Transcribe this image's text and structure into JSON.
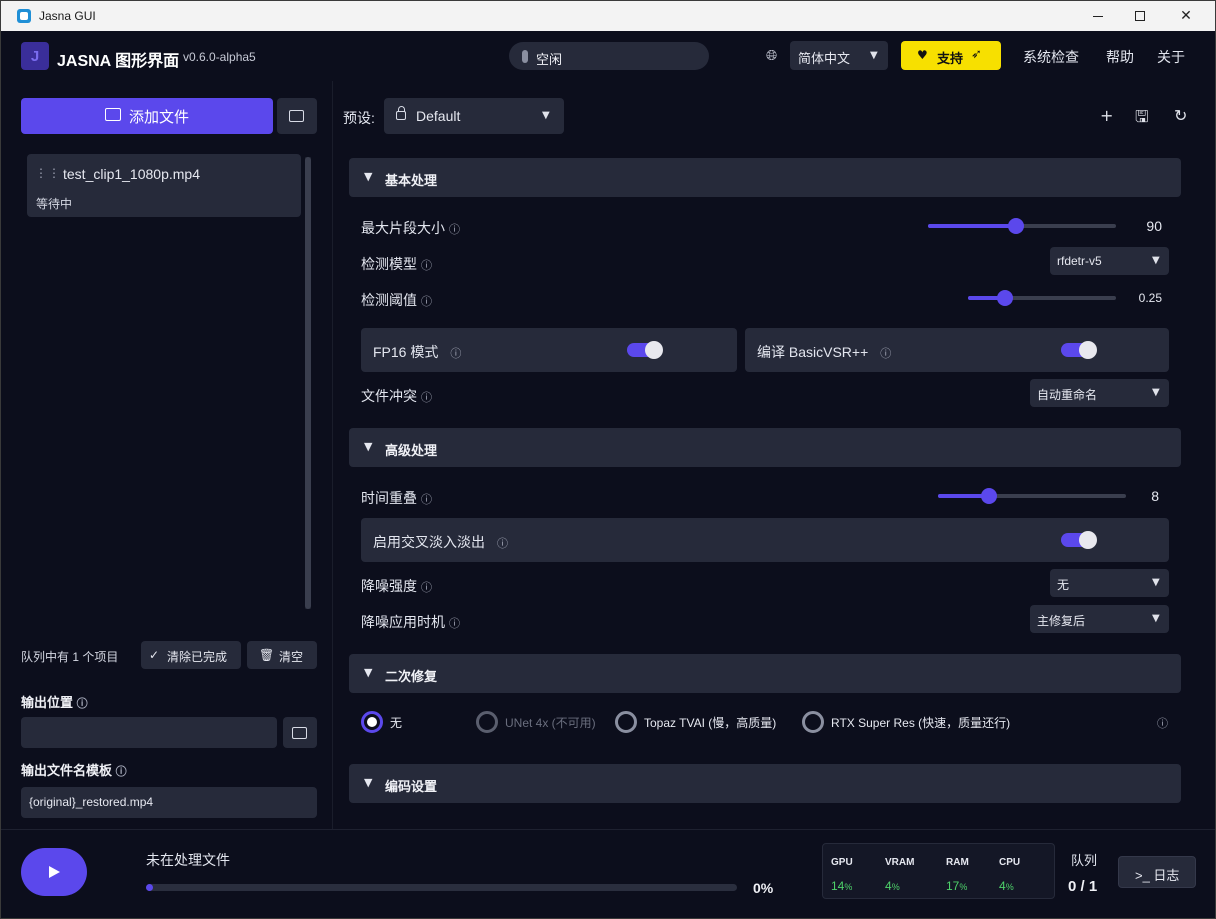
{
  "window": {
    "title": "Jasna GUI"
  },
  "header": {
    "logo_letter": "J",
    "app_name": "JASNA 图形界面",
    "version": "v0.6.0-alpha5",
    "status": "空闲",
    "language": "简体中文",
    "support_label": "支持",
    "links": [
      "系统检查",
      "帮助",
      "关于"
    ]
  },
  "left": {
    "add_files_label": "添加文件",
    "queue": [
      {
        "file": "test_clip1_1080p.mp4",
        "state": "等待中"
      }
    ],
    "queue_count": "队列中有 1 个项目",
    "clear_completed_label": "清除已完成",
    "clear_label": "清空",
    "output_location_label": "输出位置",
    "output_location_value": "",
    "filename_template_label": "输出文件名模板",
    "filename_template_value": "{original}_restored.mp4"
  },
  "right": {
    "preset_label": "预设:",
    "preset_value": "Default",
    "sections": {
      "basic": "基本处理",
      "advanced": "高级处理",
      "secondary": "二次修复",
      "encoding": "编码设置"
    },
    "basic": {
      "max_segment": {
        "label": "最大片段大小",
        "value": "90",
        "fraction": 0.47
      },
      "detection_model": {
        "label": "检测模型",
        "value": "rfdetr-v5"
      },
      "detection_threshold": {
        "label": "检测阈值",
        "value": "0.25",
        "fraction": 0.25
      },
      "fp16": {
        "label": "FP16 模式",
        "on": true
      },
      "compile": {
        "label": "编译 BasicVSR++",
        "on": true
      },
      "file_conflict": {
        "label": "文件冲突",
        "value": "自动重命名"
      }
    },
    "advanced": {
      "temporal_overlap": {
        "label": "时间重叠",
        "value": "8",
        "fraction": 0.27
      },
      "crossfade": {
        "label": "启用交叉淡入淡出",
        "on": true
      },
      "denoise_strength": {
        "label": "降噪强度",
        "value": "无"
      },
      "denoise_timing": {
        "label": "降噪应用时机",
        "value": "主修复后"
      }
    },
    "secondary": {
      "options": [
        {
          "label": "无",
          "selected": true,
          "disabled": false
        },
        {
          "label": "UNet 4x (不可用)",
          "selected": false,
          "disabled": true
        },
        {
          "label": "Topaz TVAI (慢，高质量)",
          "selected": false,
          "disabled": false
        },
        {
          "label": "RTX Super Res (快速，质量还行)",
          "selected": false,
          "disabled": false
        }
      ]
    }
  },
  "bottom": {
    "processing_label": "未在处理文件",
    "progress_percent": "0%",
    "progress_fraction": 0,
    "stats": [
      {
        "key": "GPU",
        "value": "14",
        "unit": "%"
      },
      {
        "key": "VRAM",
        "value": "4",
        "unit": "%"
      },
      {
        "key": "RAM",
        "value": "17",
        "unit": "%"
      },
      {
        "key": "CPU",
        "value": "4",
        "unit": "%"
      }
    ],
    "queue_label": "队列",
    "queue_value": "0 / 1",
    "log_label": ">_ 日志"
  },
  "colors": {
    "accent": "#5b48ec",
    "background": "#0c0e1c",
    "card": "#262a3a",
    "support_yellow": "#f7e000",
    "stat_green": "#4ed26a"
  },
  "icons": [
    "app-icon",
    "folder-icon",
    "globe-icon",
    "heart-icon",
    "rocket-icon",
    "lock-icon",
    "plus-icon",
    "save-icon",
    "reset-icon",
    "play-icon",
    "info-icon",
    "chevron-down-icon",
    "grip-icon",
    "check-icon",
    "trash-icon"
  ]
}
